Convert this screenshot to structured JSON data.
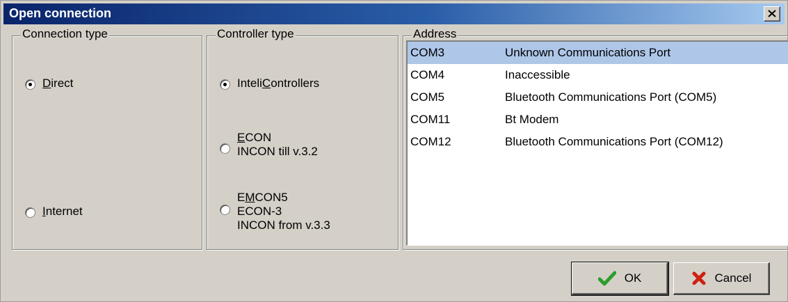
{
  "window": {
    "title": "Open connection"
  },
  "connection_type": {
    "label": "Connection type",
    "options": [
      {
        "pre": "",
        "accel": "D",
        "post": "irect",
        "checked": true
      },
      {
        "pre": "",
        "accel": "I",
        "post": "nternet",
        "checked": false
      }
    ]
  },
  "controller_type": {
    "label": "Controller type",
    "options": [
      {
        "line1_pre": "Inteli",
        "line1_accel": "C",
        "line1_post": "ontrollers",
        "checked": true
      },
      {
        "line1_pre": "",
        "line1_accel": "E",
        "line1_post": "CON",
        "line2": "INCON till v.3.2",
        "checked": false
      },
      {
        "line1_pre": "E",
        "line1_accel": "M",
        "line1_post": "CON5",
        "line2": "ECON-3",
        "line3": "INCON from v.3.3",
        "checked": false
      }
    ]
  },
  "address": {
    "label": "Address",
    "rows": [
      {
        "port": "COM3",
        "desc": "Unknown Communications Port",
        "selected": true
      },
      {
        "port": "COM4",
        "desc": "Inaccessible",
        "selected": false
      },
      {
        "port": "COM5",
        "desc": "Bluetooth Communications Port (COM5)",
        "selected": false
      },
      {
        "port": "COM11",
        "desc": "Bt Modem",
        "selected": false
      },
      {
        "port": "COM12",
        "desc": "Bluetooth Communications Port (COM12)",
        "selected": false
      }
    ]
  },
  "buttons": {
    "ok": "OK",
    "cancel": "Cancel"
  },
  "icons": {
    "ok": "checkmark-icon",
    "cancel": "x-icon",
    "close": "close-icon"
  },
  "colors": {
    "title_start": "#0a246a",
    "title_end": "#a6caf0",
    "selection": "#aec6e8",
    "ok_check": "#2e9d2e",
    "cancel_x": "#d02010"
  }
}
